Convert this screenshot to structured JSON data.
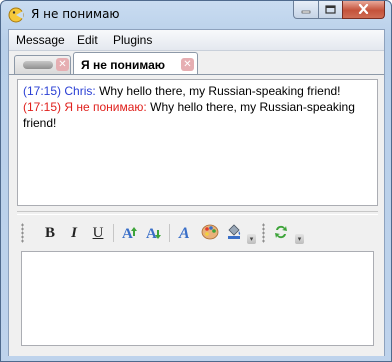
{
  "window": {
    "title": "Я не понимаю",
    "controls": {
      "minimize_icon": "minimize-icon",
      "maximize_icon": "maximize-icon",
      "close_icon": "close-icon"
    }
  },
  "menubar": {
    "items": [
      {
        "label": "Message"
      },
      {
        "label": "Edit"
      },
      {
        "label": "Plugins"
      }
    ]
  },
  "tabs": [
    {
      "label": "",
      "active": false,
      "icon": "blurred-avatar-icon"
    },
    {
      "label": "Я не понимаю",
      "active": true
    }
  ],
  "chat": {
    "messages": [
      {
        "time": "(17:15)",
        "sender": "Chris:",
        "text": "Why hello there, my Russian-speaking friend!",
        "color": "#2a3fd4"
      },
      {
        "time": "(17:15)",
        "sender": "Я не понимаю:",
        "text": "Why hello there, my Russian-speaking friend!",
        "color": "#e0201c"
      }
    ]
  },
  "toolbar": {
    "buttons": [
      "bold",
      "italic",
      "underline",
      "grow-font",
      "shrink-font",
      "font-face",
      "color-palette",
      "background-fill",
      "insert-smiley"
    ],
    "bold_glyph": "B",
    "italic_glyph": "I",
    "underline_glyph": "U",
    "font_glyph": "A"
  },
  "input": {
    "value": ""
  }
}
